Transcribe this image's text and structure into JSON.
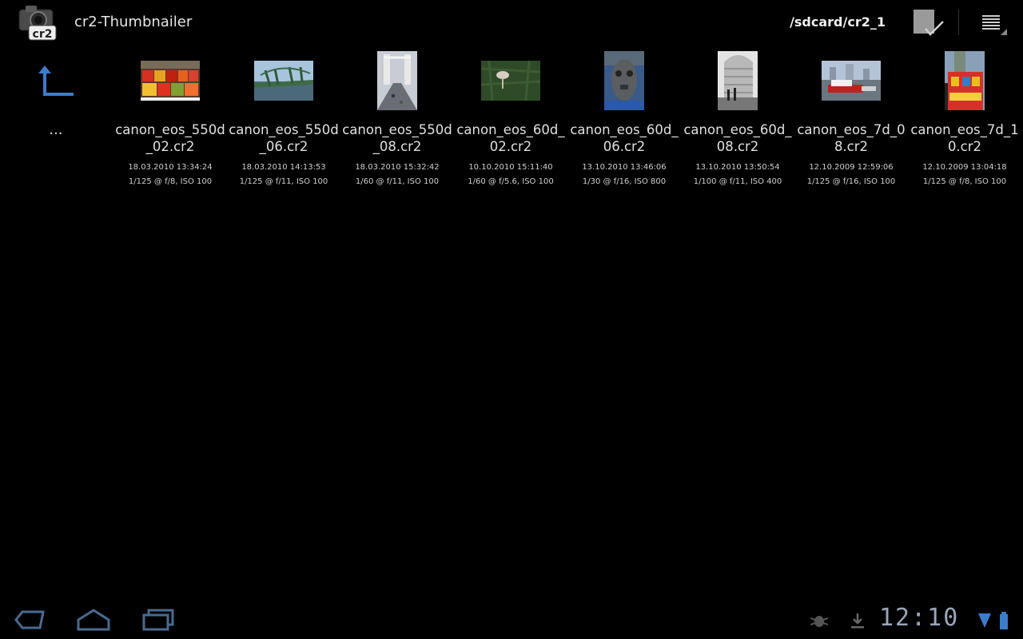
{
  "app": {
    "title": "cr2-Thumbnailer",
    "icon_badge": "cr2",
    "path": "/sdcard/cr2_1"
  },
  "up_item": {
    "label": "..."
  },
  "files": [
    {
      "name": "canon_eos_550d_02.cr2",
      "date": "18.03.2010 13:34:24",
      "exposure": "1/125 @ f/8, ISO 100"
    },
    {
      "name": "canon_eos_550d_06.cr2",
      "date": "18.03.2010 14:13:53",
      "exposure": "1/125 @ f/11, ISO 100"
    },
    {
      "name": "canon_eos_550d_08.cr2",
      "date": "18.03.2010 15:32:42",
      "exposure": "1/60 @ f/11, ISO 100"
    },
    {
      "name": "canon_eos_60d_02.cr2",
      "date": "10.10.2010 15:11:40",
      "exposure": "1/60 @ f/5.6, ISO 100"
    },
    {
      "name": "canon_eos_60d_06.cr2",
      "date": "13.10.2010 13:46:06",
      "exposure": "1/30 @ f/16, ISO 800"
    },
    {
      "name": "canon_eos_60d_08.cr2",
      "date": "13.10.2010 13:50:54",
      "exposure": "1/100 @ f/11, ISO 400"
    },
    {
      "name": "canon_eos_7d_08.cr2",
      "date": "12.10.2009 12:59:06",
      "exposure": "1/125 @ f/16, ISO 100"
    },
    {
      "name": "canon_eos_7d_10.cr2",
      "date": "12.10.2009 13:04:18",
      "exposure": "1/125 @ f/8, ISO 100"
    }
  ],
  "status": {
    "time": "12:10"
  },
  "colors": {
    "accent": "#3d7cc9",
    "background": "#000000"
  }
}
